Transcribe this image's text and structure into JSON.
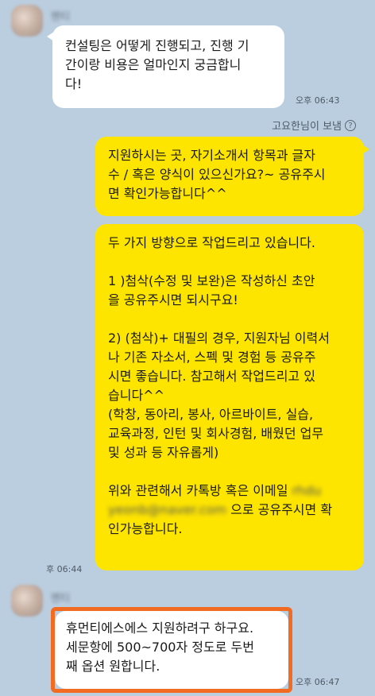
{
  "chat": {
    "sender_name_1": "멘티",
    "msg1": {
      "lines": [
        "컨설팅은 어떻게 진행되고, 진행 기",
        "간이랑 비용은 얼마인지 궁금합니",
        "다!"
      ],
      "time": "오후 06:43"
    },
    "from_note": {
      "text": "고요한님이 보냄",
      "icon": "?"
    },
    "msg2": {
      "lines": [
        "지원하시는 곳, 자기소개서 항목과 글자",
        "수 / 혹은 양식이 있으신가요?~ 공유주시",
        "면 확인가능합니다^^"
      ]
    },
    "msg3": {
      "lines": [
        "두 가지 방향으로 작업드리고 있습니다.",
        "",
        "1 )첨삭(수정 및 보완)은 작성하신 초안",
        "을 공유주시면 되시구요!",
        "",
        "2) (첨삭)+ 대필의 경우, 지원자님 이력서",
        "나 기존 자소서, 스펙 및 경험 등 공유주",
        "시면 좋습니다. 참고해서 작업드리고 있",
        "습니다^^",
        "(학창, 동아리, 봉사, 아르바이트, 실습,",
        "교육과정, 인턴 및 회사경험, 배웠던 업무",
        "및 성과 등 자유롭게)",
        "",
        "위와 관련해서 카톡방 혹은 이메일"
      ],
      "email_blur_1": "rhdu",
      "email_blur_2": "yeonb@naver.com",
      "email_suffix": "으로 공유주시면 확",
      "last_line": "인가능합니다.",
      "time": "후 06:44"
    },
    "sender_name_2": "멘티",
    "msg4": {
      "lines": [
        "휴먼티에스에스 지원하려구 하구요.",
        "세문항에 500~700자 정도로 두번",
        "째 옵션 원합니다."
      ],
      "time": "오후 06:47"
    }
  },
  "colors": {
    "background": "#bacee0",
    "my_bubble": "#fee500",
    "their_bubble": "#ffffff",
    "highlight_border": "#f26b23"
  }
}
